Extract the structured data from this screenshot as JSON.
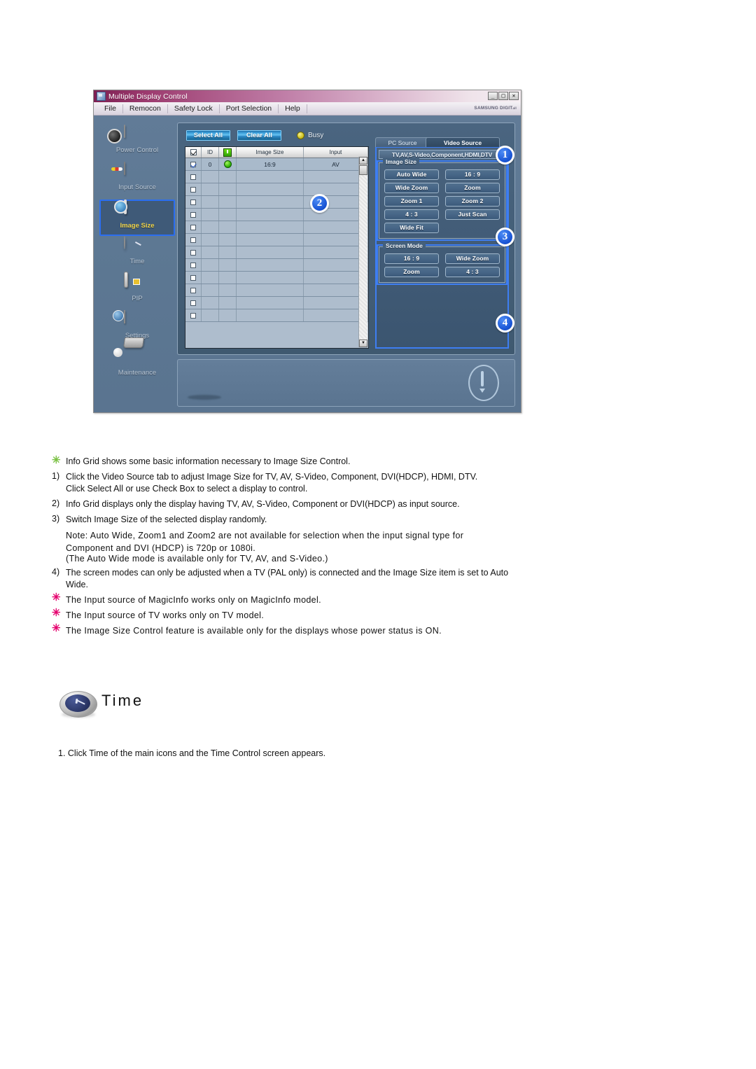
{
  "app": {
    "window_title": "Multiple Display Control",
    "brand": "SAMSUNG DIGIT",
    "brand_small": "all",
    "menu": [
      "File",
      "Remocon",
      "Safety Lock",
      "Port Selection",
      "Help"
    ],
    "window_buttons": [
      "_",
      "□",
      "✕"
    ],
    "sidebar": [
      {
        "label": "Power Control",
        "icon": "power-control-icon",
        "selected": false
      },
      {
        "label": "Input Source",
        "icon": "input-source-icon",
        "selected": false
      },
      {
        "label": "Image Size",
        "icon": "image-size-icon",
        "selected": true
      },
      {
        "label": "Time",
        "icon": "time-clock-icon",
        "selected": false
      },
      {
        "label": "PIP",
        "icon": "pip-icon",
        "selected": false
      },
      {
        "label": "Settings",
        "icon": "settings-cube-icon",
        "selected": false
      },
      {
        "label": "Maintenance",
        "icon": "maintenance-icon",
        "selected": false
      }
    ],
    "toolbar": {
      "select_all": "Select All",
      "clear_all": "Clear All",
      "busy_label": "Busy"
    },
    "grid": {
      "headers": [
        "",
        "ID",
        "",
        "Image Size",
        "Input"
      ],
      "header_icons": [
        "checkbox-checked-icon",
        null,
        "power-status-icon",
        null,
        null
      ],
      "rows": [
        {
          "checked": true,
          "id": "0",
          "power": "on",
          "image_size": "16:9",
          "input": "AV"
        },
        {
          "checked": false,
          "id": "",
          "power": "",
          "image_size": "",
          "input": ""
        },
        {
          "checked": false,
          "id": "",
          "power": "",
          "image_size": "",
          "input": ""
        },
        {
          "checked": false,
          "id": "",
          "power": "",
          "image_size": "",
          "input": ""
        },
        {
          "checked": false,
          "id": "",
          "power": "",
          "image_size": "",
          "input": ""
        },
        {
          "checked": false,
          "id": "",
          "power": "",
          "image_size": "",
          "input": ""
        },
        {
          "checked": false,
          "id": "",
          "power": "",
          "image_size": "",
          "input": ""
        },
        {
          "checked": false,
          "id": "",
          "power": "",
          "image_size": "",
          "input": ""
        },
        {
          "checked": false,
          "id": "",
          "power": "",
          "image_size": "",
          "input": ""
        },
        {
          "checked": false,
          "id": "",
          "power": "",
          "image_size": "",
          "input": ""
        },
        {
          "checked": false,
          "id": "",
          "power": "",
          "image_size": "",
          "input": ""
        },
        {
          "checked": false,
          "id": "",
          "power": "",
          "image_size": "",
          "input": ""
        },
        {
          "checked": false,
          "id": "",
          "power": "",
          "image_size": "",
          "input": ""
        }
      ],
      "scroll_up": "▲",
      "scroll_down": "▼"
    },
    "control_panel": {
      "tabs": [
        {
          "label": "PC Source",
          "active": false
        },
        {
          "label": "Video Source",
          "active": true
        }
      ],
      "source_title": "TV,AV,S-Video,Component,HDMI,DTV",
      "image_size": {
        "legend": "Image Size",
        "buttons": [
          "Auto Wide",
          "16 : 9",
          "Wide Zoom",
          "Zoom",
          "Zoom 1",
          "Zoom 2",
          "4 : 3",
          "Just Scan",
          "Wide Fit"
        ]
      },
      "screen_mode": {
        "legend": "Screen Mode",
        "buttons": [
          "16 : 9",
          "Wide Zoom",
          "Zoom",
          "4 : 3"
        ]
      }
    },
    "badges": [
      "1",
      "2",
      "3",
      "4"
    ]
  },
  "doc": {
    "star1": "Info Grid shows some basic information necessary to Image Size Control.",
    "item1_num": "1)",
    "item1_line1": "Click the Video Source tab to adjust Image Size for TV, AV, S-Video, Component, DVI(HDCP), HDMI, DTV.",
    "item1_line2": "Click Select All or use Check Box to select a display to control.",
    "item2_num": "2)",
    "item2": "Info Grid displays only the display having TV, AV, S-Video, Component or DVI(HDCP) as input source.",
    "item3_num": "3)",
    "item3": "Switch Image Size of the selected display randomly.",
    "note_line1": "Note: Auto Wide, Zoom1 and Zoom2 are not available for selection when the input signal type for",
    "note_line2": "Component and DVI (HDCP) is 720p or 1080i.",
    "note_line3": "(The Auto Wide mode is available only for TV, AV, and S-Video.)",
    "item4_num": "4)",
    "item4_line1": "The screen modes can only be adjusted when a TV (PAL only) is connected and the Image Size item is set to Auto",
    "item4_line2": "Wide.",
    "star2": "The Input source of MagicInfo works only on MagicInfo model.",
    "star3": "The Input source of TV works only on TV model.",
    "star4": "The Image Size Control feature is available only for the displays whose power status is ON.",
    "section_title": "Time",
    "section_step1": "1.   Click Time of the main icons and the Time Control screen appears.",
    "star_glyph": "✳"
  }
}
